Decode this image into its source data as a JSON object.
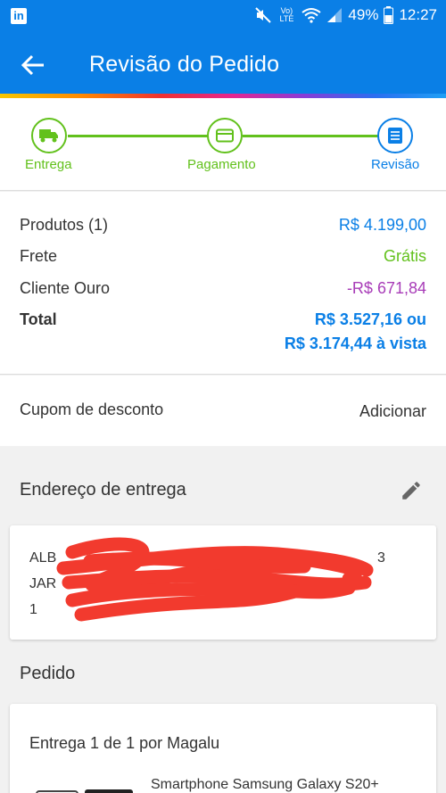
{
  "status_bar": {
    "app_icon": "linkedin-icon",
    "network": "Vo) LTE",
    "battery": "49%",
    "time": "12:27"
  },
  "header": {
    "title": "Revisão do Pedido",
    "back_icon": "arrow-left-icon"
  },
  "steps": [
    {
      "label": "Entrega",
      "icon": "truck-icon",
      "state": "done"
    },
    {
      "label": "Pagamento",
      "icon": "card-icon",
      "state": "done"
    },
    {
      "label": "Revisão",
      "icon": "list-icon",
      "state": "active"
    }
  ],
  "summary": {
    "products_label": "Produtos (1)",
    "products_value": "R$ 4.199,00",
    "shipping_label": "Frete",
    "shipping_value": "Grátis",
    "gold_label": "Cliente Ouro",
    "gold_value": "-R$ 671,84",
    "total_label": "Total",
    "total_value_installments": "R$ 3.527,16 ou",
    "total_value_cash": "R$ 3.174,44 à vista"
  },
  "coupon": {
    "label": "Cupom de desconto",
    "action": "Adicionar"
  },
  "address": {
    "title": "Endereço de entrega",
    "edit_icon": "pencil-icon",
    "line1": "ALB",
    "line1_end": "3",
    "line2": "JAR",
    "line3": "1"
  },
  "order": {
    "title": "Pedido",
    "delivery": "Entrega 1 de 1 por Magalu",
    "product_name": "Smartphone Samsung Galaxy S20+"
  },
  "colors": {
    "primary": "#0a7fe6",
    "success": "#62c11c",
    "discount": "#a83cb8",
    "redaction": "#f23a2e"
  }
}
